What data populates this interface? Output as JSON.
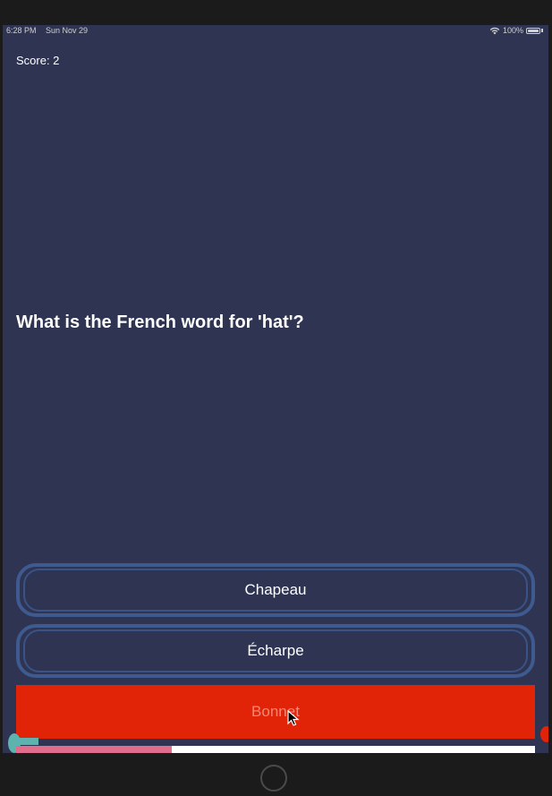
{
  "status_bar": {
    "time": "6:28 PM",
    "date": "Sun Nov 29",
    "battery": "100%"
  },
  "quiz": {
    "score_text": "Score: 2",
    "question": "What is the French word for 'hat'?",
    "options": [
      {
        "label": "Chapeau",
        "state": "default"
      },
      {
        "label": "Écharpe",
        "state": "default"
      },
      {
        "label": "Bonnet",
        "state": "wrong"
      }
    ],
    "progress_fraction": 0.3
  },
  "colors": {
    "background": "#2e3452",
    "option_border": "#3e5a8e",
    "wrong": "#e12308",
    "progress": "#e06c8e",
    "timer": "#5db3ad"
  }
}
